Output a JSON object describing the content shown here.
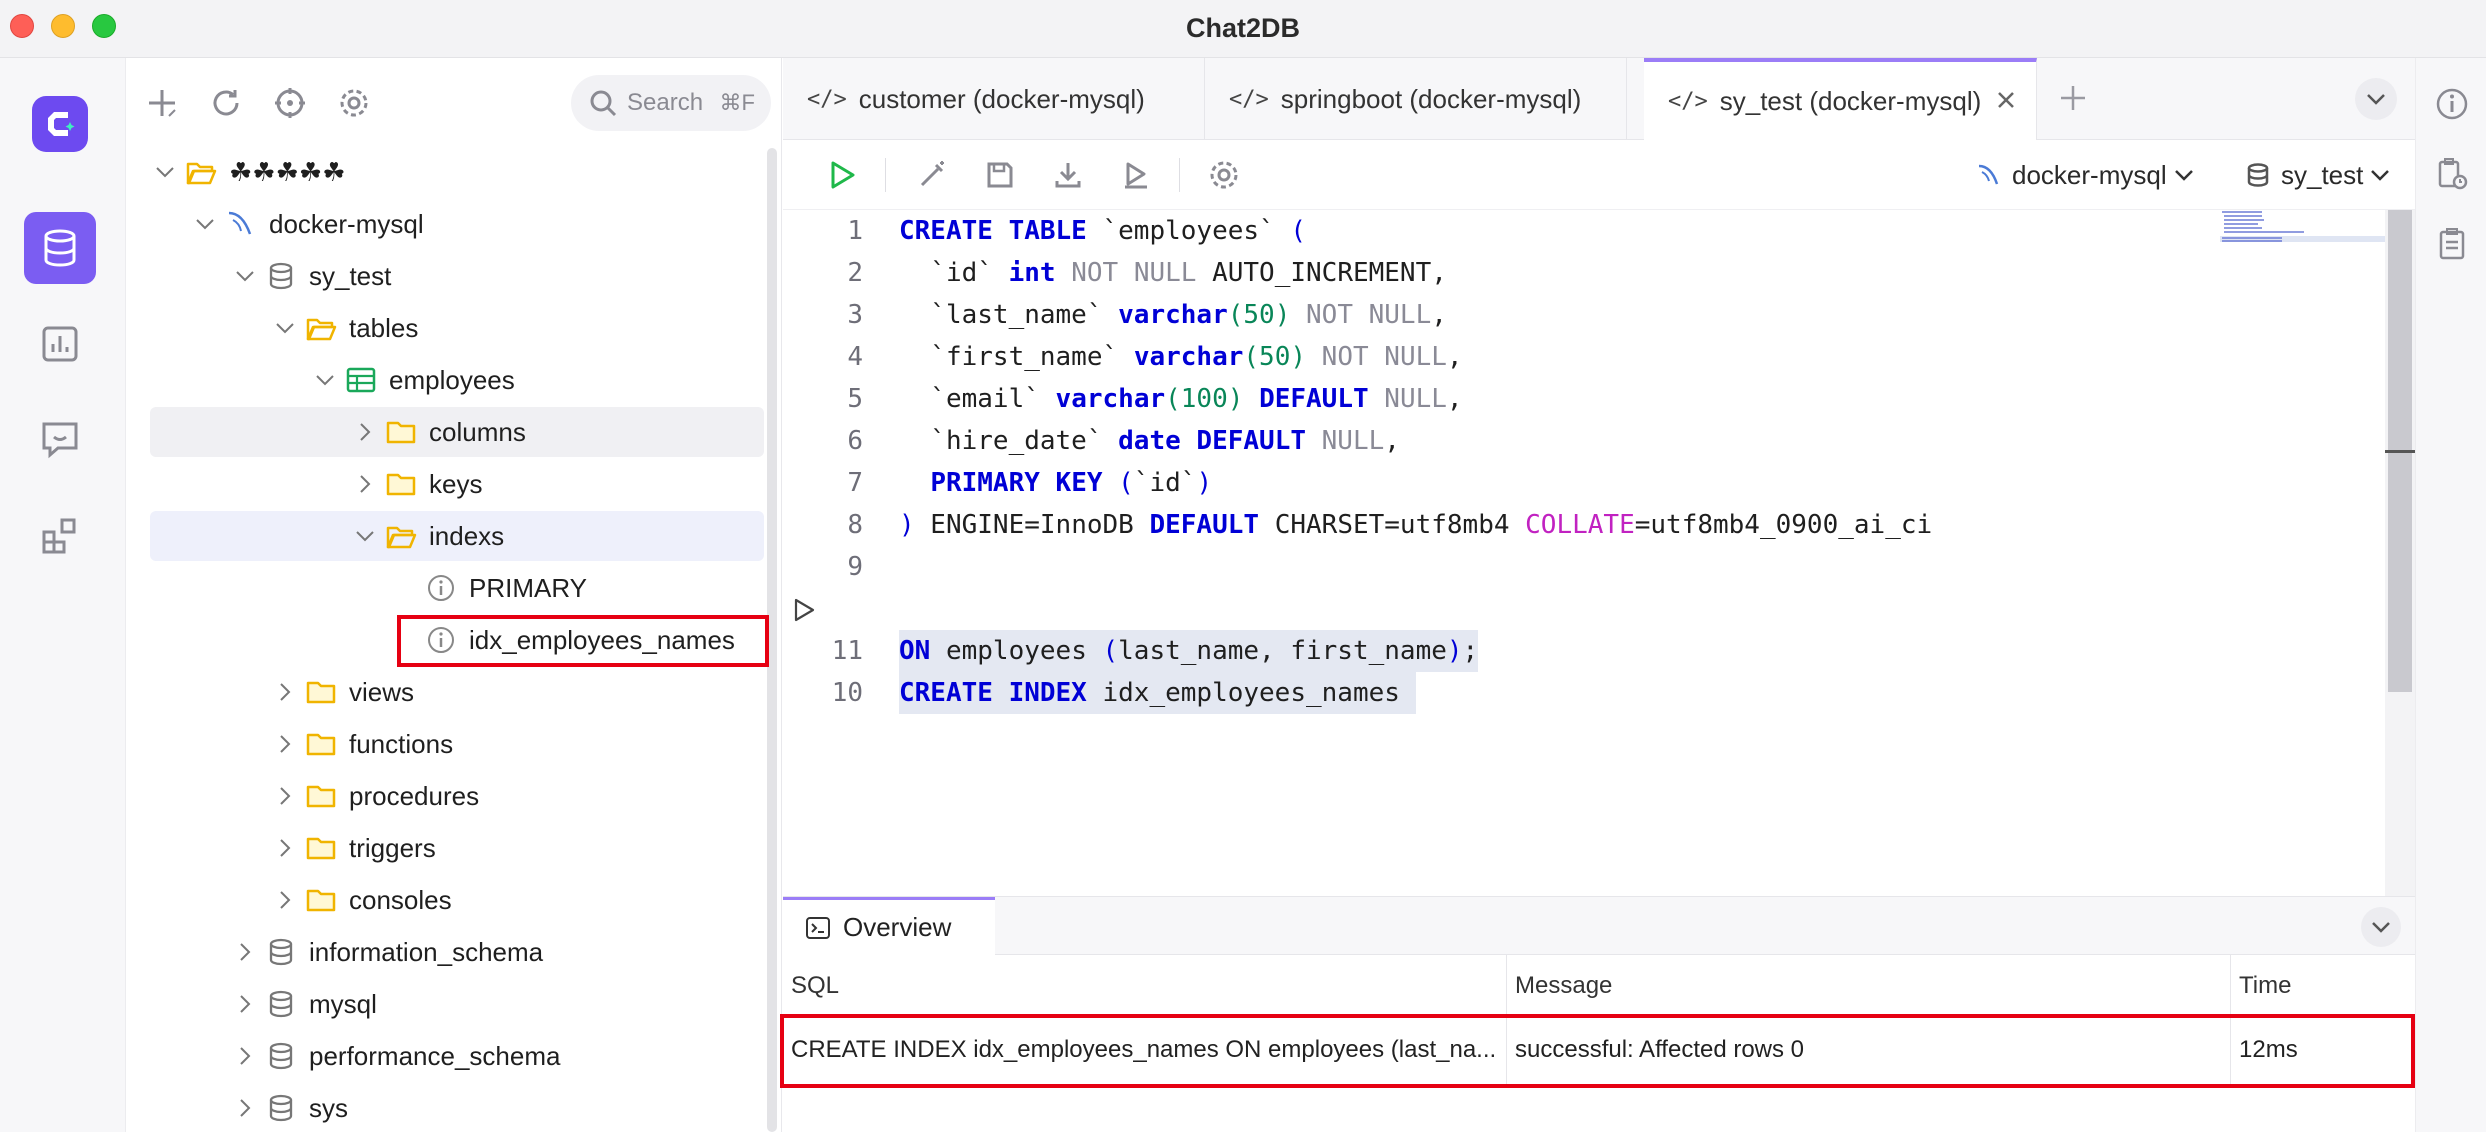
{
  "window": {
    "title": "Chat2DB"
  },
  "sidebar": {
    "search_placeholder": "Search",
    "search_shortcut": "⌘F",
    "tree": [
      {
        "label": "☘☘☘☘☘",
        "level": 0,
        "expanded": true,
        "icon": "folder-open-icon"
      },
      {
        "label": "docker-mysql",
        "level": 1,
        "expanded": true,
        "icon": "mysql-dolphin-icon"
      },
      {
        "label": "sy_test",
        "level": 2,
        "expanded": true,
        "icon": "database-icon"
      },
      {
        "label": "tables",
        "level": 3,
        "expanded": true,
        "icon": "folder-open-icon"
      },
      {
        "label": "employees",
        "level": 4,
        "expanded": true,
        "icon": "table-icon"
      },
      {
        "label": "columns",
        "level": 5,
        "expanded": false,
        "icon": "folder-icon"
      },
      {
        "label": "keys",
        "level": 5,
        "expanded": false,
        "icon": "folder-icon"
      },
      {
        "label": "indexs",
        "level": 5,
        "expanded": true,
        "icon": "folder-open-icon"
      },
      {
        "label": "PRIMARY",
        "level": 6,
        "icon": "info-icon"
      },
      {
        "label": "idx_employees_names",
        "level": 6,
        "icon": "info-icon"
      },
      {
        "label": "views",
        "level": 3,
        "expanded": false,
        "icon": "folder-icon"
      },
      {
        "label": "functions",
        "level": 3,
        "expanded": false,
        "icon": "folder-icon"
      },
      {
        "label": "procedures",
        "level": 3,
        "expanded": false,
        "icon": "folder-icon"
      },
      {
        "label": "triggers",
        "level": 3,
        "expanded": false,
        "icon": "folder-icon"
      },
      {
        "label": "consoles",
        "level": 3,
        "expanded": false,
        "icon": "folder-icon"
      },
      {
        "label": "information_schema",
        "level": 2,
        "expanded": false,
        "icon": "database-icon"
      },
      {
        "label": "mysql",
        "level": 2,
        "expanded": false,
        "icon": "database-icon"
      },
      {
        "label": "performance_schema",
        "level": 2,
        "expanded": false,
        "icon": "database-icon"
      },
      {
        "label": "sys",
        "level": 2,
        "expanded": false,
        "icon": "database-icon"
      }
    ]
  },
  "tabs": [
    {
      "label": "customer (docker-mysql)",
      "active": false
    },
    {
      "label": "springboot (docker-mysql)",
      "active": false
    },
    {
      "label": "sy_test (docker-mysql)",
      "active": true
    }
  ],
  "toolbar": {
    "connection": "docker-mysql",
    "database": "sy_test"
  },
  "editor": {
    "line_numbers": [
      "1",
      "2",
      "3",
      "4",
      "5",
      "6",
      "7",
      "8",
      "9",
      "10",
      "11"
    ]
  },
  "results": {
    "tab_label": "Overview",
    "columns": [
      "SQL",
      "Message",
      "Time"
    ],
    "rows": [
      {
        "sql": "CREATE INDEX idx_employees_names ON employees (last_na...",
        "message": "successful: Affected rows 0",
        "time": "12ms"
      }
    ]
  },
  "colors": {
    "accent": "#7b5df2",
    "highlight_box": "#e60012",
    "keyword": "#0000d6"
  }
}
